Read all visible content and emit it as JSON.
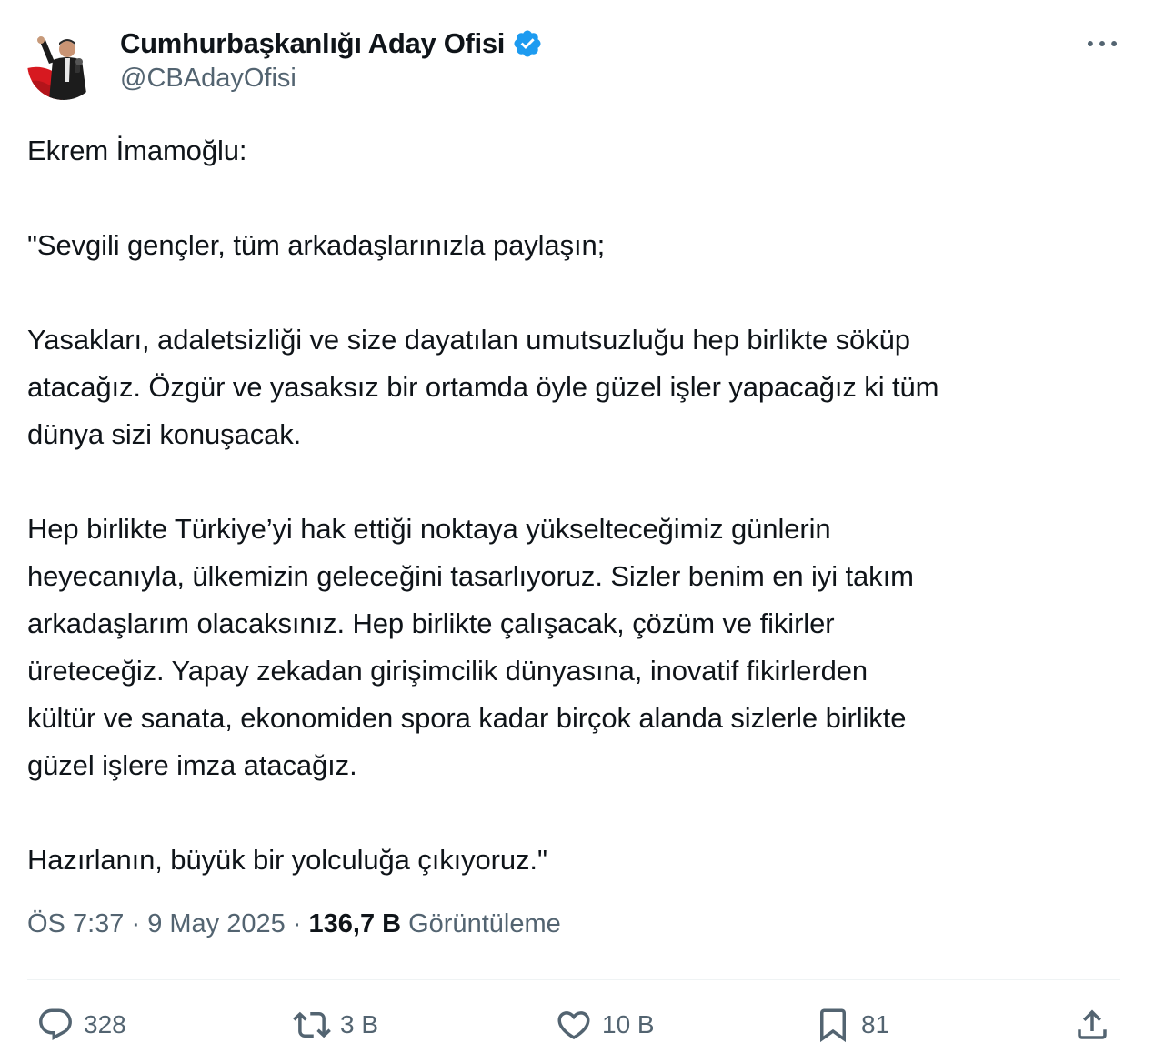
{
  "author": {
    "display_name": "Cumhurbaşkanlığı Aday Ofisi",
    "handle": "@CBAdayOfisi",
    "verified": true,
    "avatar_icon": "profile-photo"
  },
  "more_icon": "more-horizontal-icon",
  "tweet": {
    "paragraphs": [
      "Ekrem İmamoğlu:",
      "\"Sevgili gençler, tüm arkadaşlarınızla paylaşın;",
      "Yasakları, adaletsizliği ve size dayatılan umutsuzluğu hep birlikte söküp\natacağız. Özgür ve yasaksız bir ortamda öyle güzel işler yapacağız ki tüm\ndünya sizi konuşacak.",
      "Hep birlikte Türkiye’yi hak ettiği noktaya yükselteceğimiz günlerin\nheyecanıyla, ülkemizin geleceğini tasarlıyoruz. Sizler benim en iyi takım\narkadaşlarım olacaksınız. Hep birlikte çalışacak, çözüm ve fikirler\nüreteceğiz. Yapay zekadan girişimcilik dünyasına, inovatif fikirlerden\nkültür ve sanata, ekonomiden spora kadar birçok alanda sizlerle birlikte\ngüzel işlere imza atacağız.",
      "Hazırlanın, büyük bir yolculuğa çıkıyoruz.\""
    ]
  },
  "meta": {
    "time": "ÖS 7:37",
    "separator": " · ",
    "date": "9 May 2025",
    "views_count": "136,7 B",
    "views_label": "Görüntüleme"
  },
  "actions": {
    "reply": {
      "icon": "reply-icon",
      "count": "328"
    },
    "retweet": {
      "icon": "retweet-icon",
      "count": "3 B"
    },
    "like": {
      "icon": "heart-icon",
      "count": "10 B"
    },
    "bookmark": {
      "icon": "bookmark-icon",
      "count": "81"
    },
    "share": {
      "icon": "share-icon"
    }
  },
  "colors": {
    "text_primary": "#0f1419",
    "text_secondary": "#536471",
    "verified_blue": "#1d9bf0",
    "divider": "#eff3f4"
  }
}
